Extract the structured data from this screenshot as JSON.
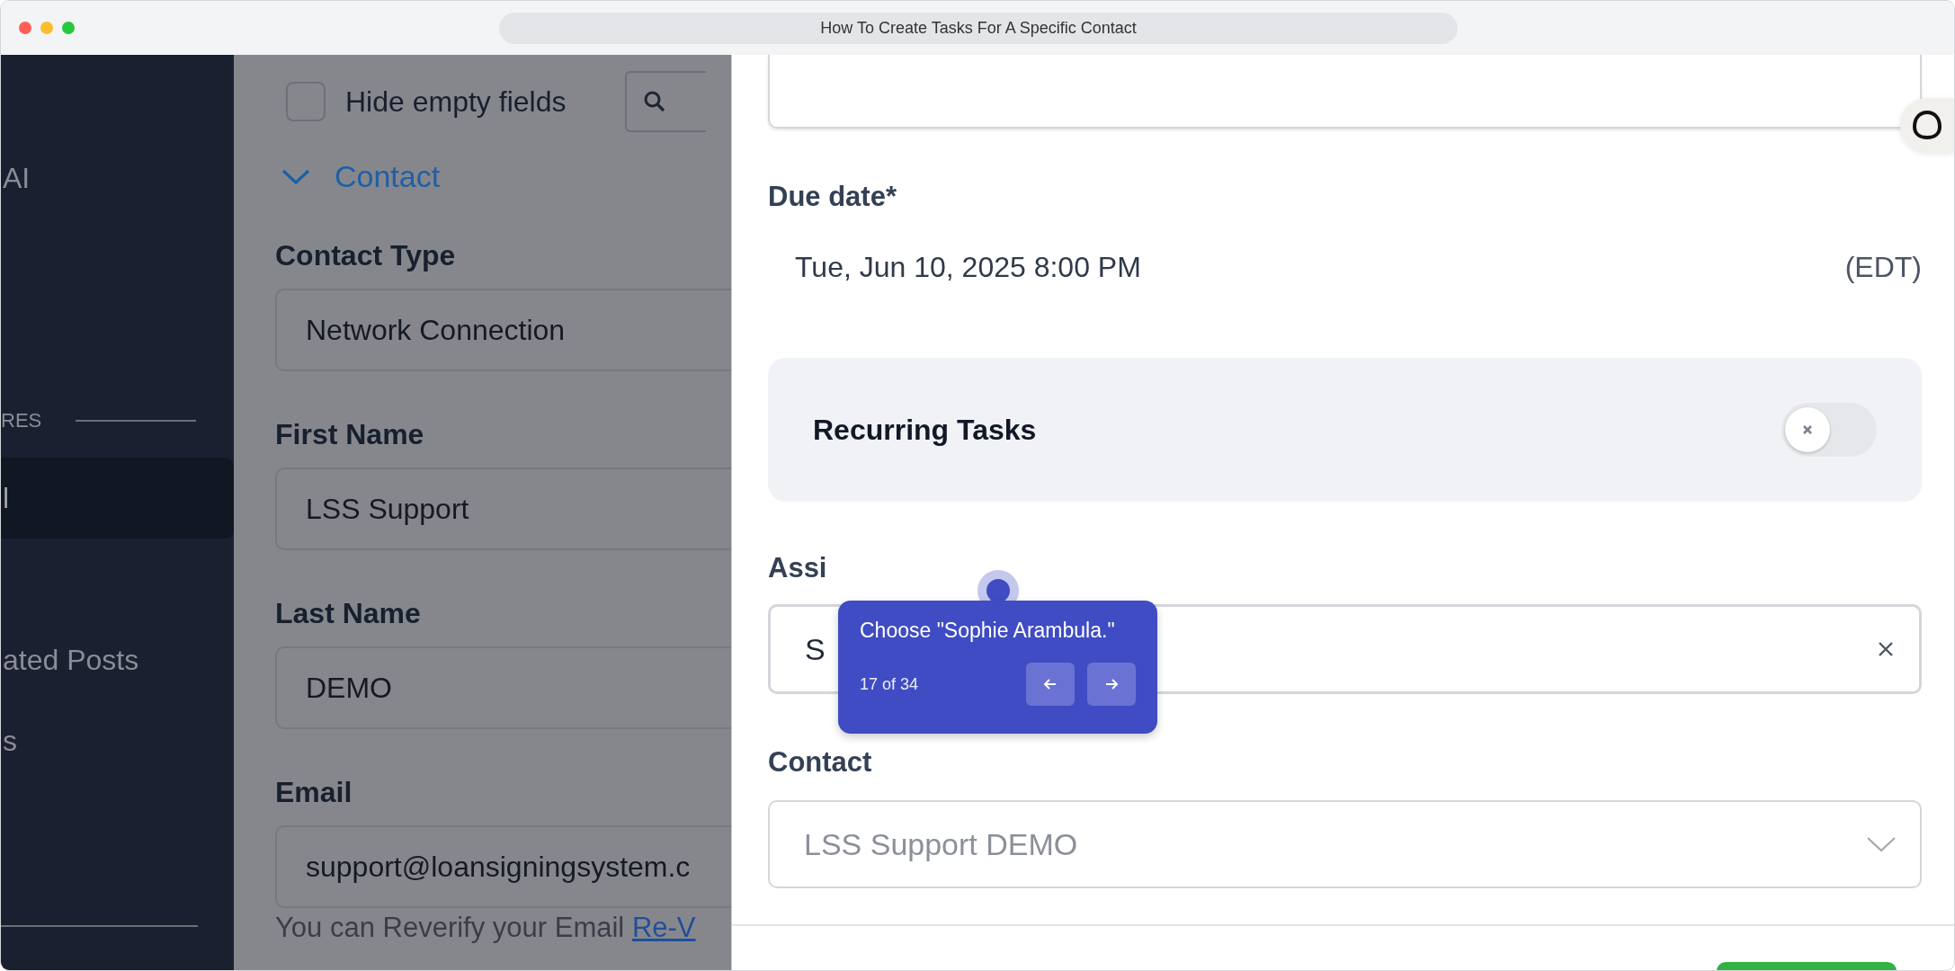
{
  "window": {
    "title": "How To Create Tasks For A Specific Contact"
  },
  "sidebar": {
    "items": [
      {
        "label": "AI",
        "kind": "item",
        "selected": false
      },
      {
        "label": "RES",
        "kind": "section"
      },
      {
        "label": "l",
        "kind": "item",
        "selected": true
      },
      {
        "label": "ated Posts",
        "kind": "item",
        "selected": false
      },
      {
        "label": "s",
        "kind": "item",
        "selected": false
      }
    ]
  },
  "contact_form": {
    "hide_empty": {
      "label": "Hide empty fields",
      "checked": false
    },
    "section": {
      "label": "Contact",
      "expanded": true
    },
    "fields": [
      {
        "label": "Contact Type",
        "value": "Network Connection"
      },
      {
        "label": "First Name",
        "value": "LSS Support"
      },
      {
        "label": "Last Name",
        "value": "DEMO"
      },
      {
        "label": "Email",
        "value": "support@loansigningsystem.c"
      }
    ],
    "email_hint": {
      "text": "You can Reverify your Email",
      "link": "Re-V"
    }
  },
  "task_panel": {
    "due_date": {
      "label": "Due date*",
      "value": "Tue, Jun 10, 2025 8:00 PM",
      "timezone": "(EDT)"
    },
    "recurring": {
      "label": "Recurring Tasks",
      "on": false
    },
    "assignee": {
      "label": "Assi",
      "value": "S"
    },
    "contact": {
      "label": "Contact",
      "value": "LSS Support DEMO"
    }
  },
  "guide": {
    "text": "Choose \"Sophie Arambula.\"",
    "step": "17 of 34"
  }
}
